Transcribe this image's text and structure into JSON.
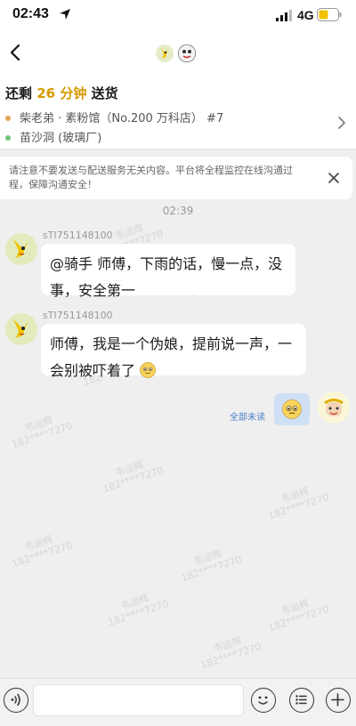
{
  "status_bar": {
    "time": "02:43",
    "network": "4G"
  },
  "order": {
    "title_prefix": "还剩",
    "minutes": "26 分钟",
    "title_suffix": "送货",
    "store": "柴老弟 · 素粉馆（No.200 万科店） #7",
    "destination": "苗沙洞 (玻璃厂)",
    "store_dot_color": "#e8a25c",
    "dest_dot_color": "#6cc27a"
  },
  "notice": {
    "text": "请注意不要发送与配送服务无关内容。平台将全程监控在线沟通过程，保障沟通安全！"
  },
  "chat": {
    "timestamp": "02:39",
    "messages": [
      {
        "sender": "sTI751148100",
        "text": "@骑手 师傅，下雨的话，慢一点，没事，安全第一"
      },
      {
        "sender": "sTI751148100",
        "text": "师傅，我是一个伪娘，提前说一声，一会别被吓着了"
      }
    ],
    "outgoing": {
      "read_status": "全部未读"
    }
  },
  "watermark": {
    "name": "韦运辉",
    "phone": "182****7270"
  },
  "colors": {
    "accent": "#d69a00",
    "read_status": "#4a7ec7",
    "outgoing_bubble": "#cfe0f6"
  },
  "icons": {
    "location": "location-arrow-icon",
    "back": "chevron-left-icon",
    "close": "close-icon",
    "voice": "voice-icon",
    "emoji": "smile-icon",
    "menu": "list-icon",
    "plus": "plus-icon"
  }
}
